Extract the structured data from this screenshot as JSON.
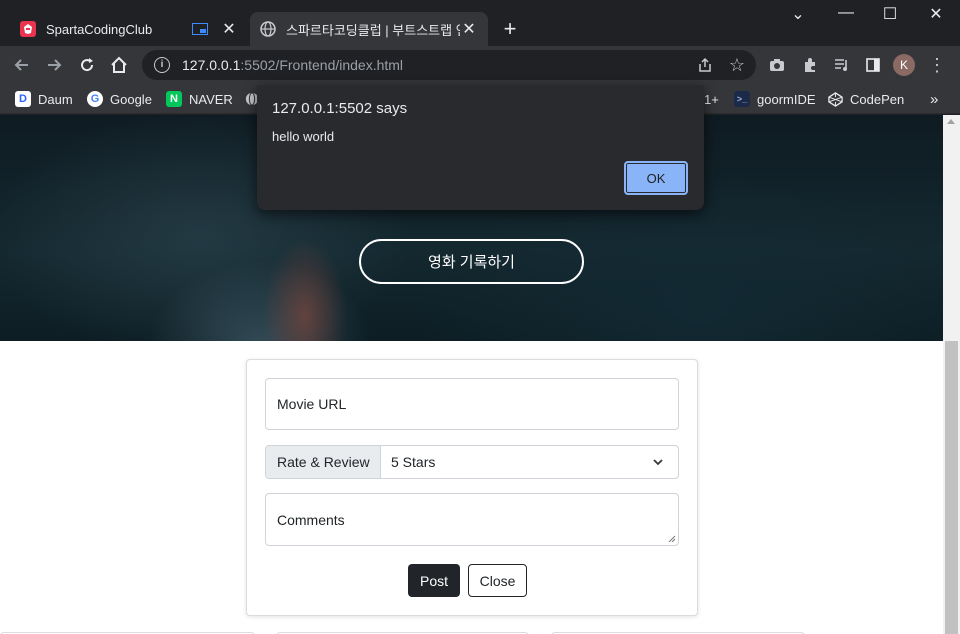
{
  "browser": {
    "tabs": [
      {
        "title": "SpartaCodingClub",
        "favicon_color": "#e8344e"
      },
      {
        "title": "스파르타코딩클럽 | 부트스트랩 연습"
      }
    ],
    "new_tab_label": "+",
    "window_controls": {
      "minimize": "—",
      "maximize": "☐",
      "close": "✕",
      "tab_search": "⌄"
    },
    "address": {
      "host": "127.0.0.1",
      "path": ":5502/Frontend/index.html"
    },
    "profile_initial": "K",
    "bookmarks": [
      {
        "label": "Daum",
        "icon": "D"
      },
      {
        "label": "Google",
        "icon": "G"
      },
      {
        "label": "NAVER",
        "icon": "N"
      },
      {
        "label": "",
        "icon": "globe"
      },
      {
        "label": "1+",
        "icon": ""
      },
      {
        "label": "goormIDE",
        "icon": ">_"
      },
      {
        "label": "CodePen",
        "icon": "codepen"
      }
    ],
    "bookmarks_overflow": "»"
  },
  "page": {
    "hero_button_label": "영화 기록하기",
    "form": {
      "url_placeholder": "Movie URL",
      "rate_label": "Rate & Review",
      "rate_selected": "5 Stars",
      "comments_placeholder": "Comments",
      "post_label": "Post",
      "close_label": "Close"
    }
  },
  "dialog": {
    "title": "127.0.0.1:5502 says",
    "message": "hello world",
    "ok_label": "OK",
    "accent_color": "#8ab4f8"
  }
}
